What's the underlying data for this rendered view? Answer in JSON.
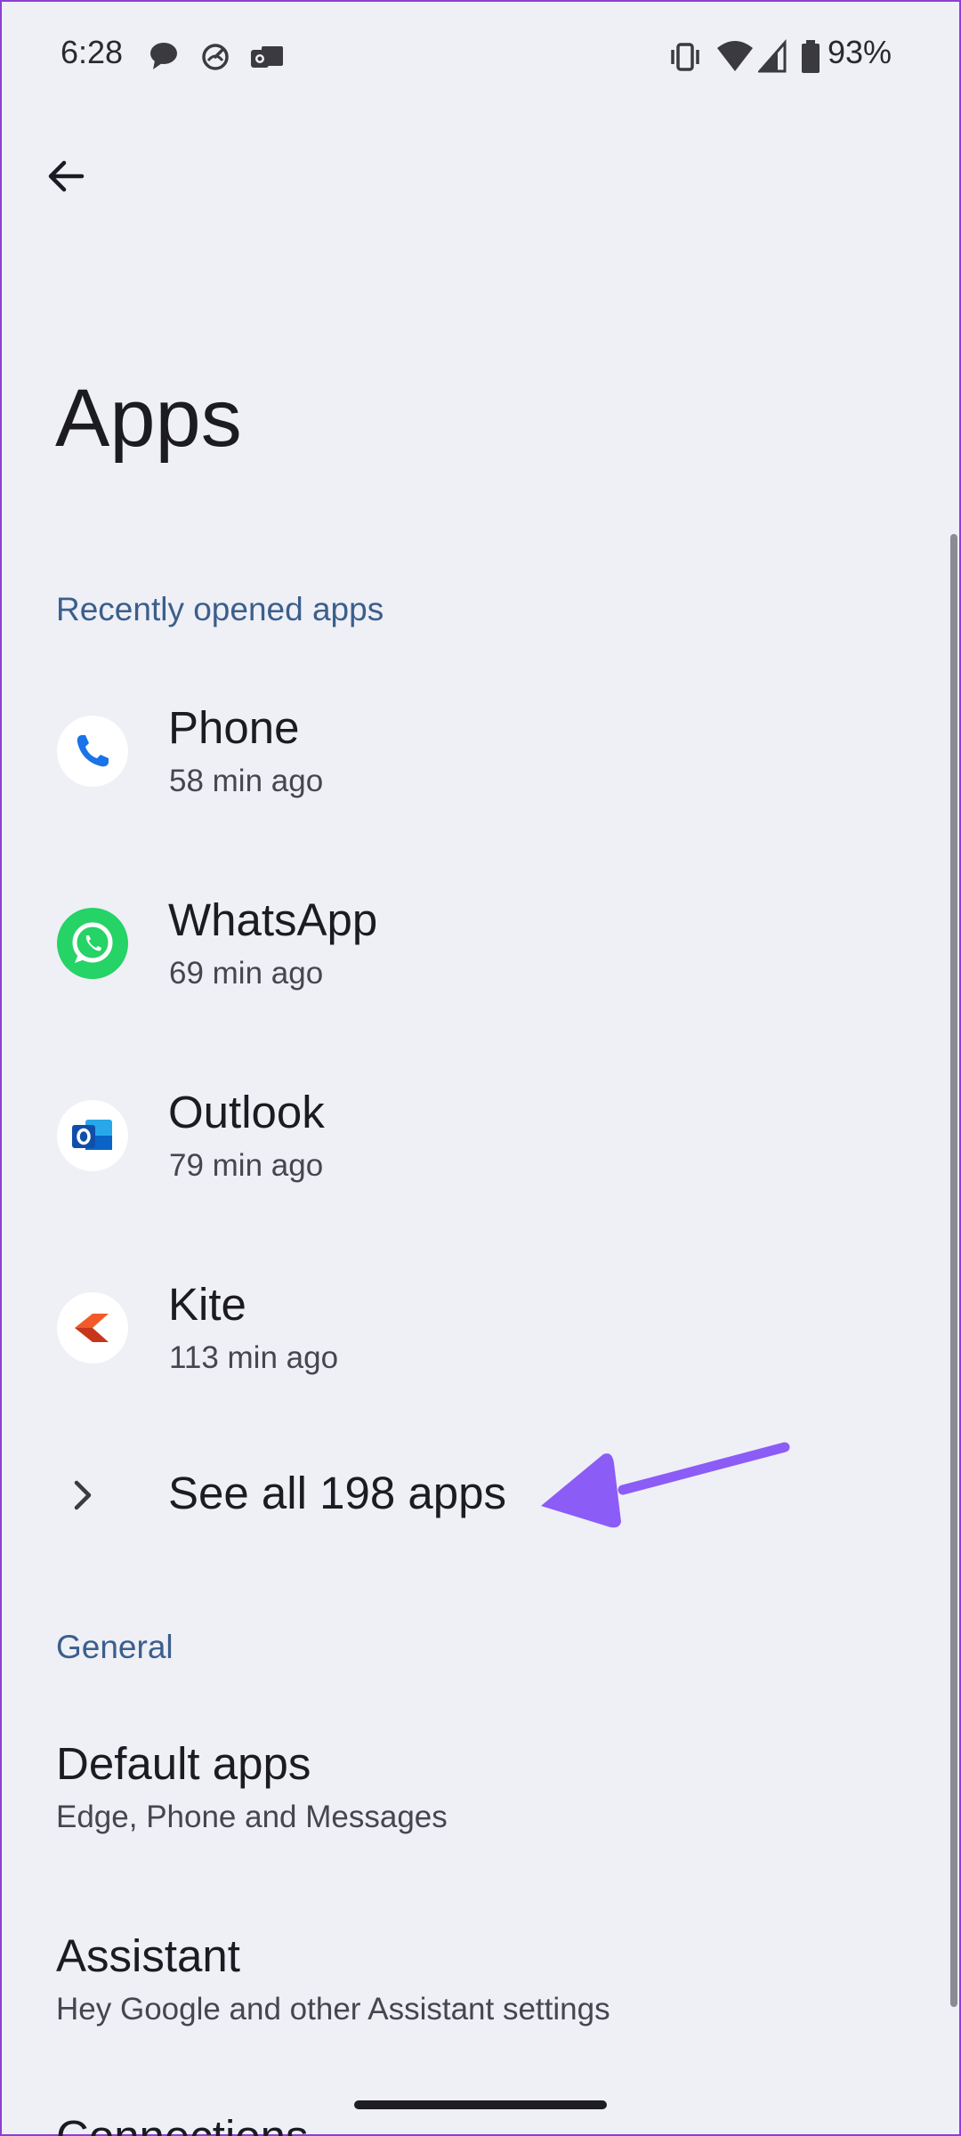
{
  "status_bar": {
    "time": "6:28",
    "battery_percent": "93%",
    "left_icons": [
      "chat-bubble-icon",
      "speed-gauge-icon",
      "outlook-notification-icon"
    ],
    "right_icons": [
      "vibrate-icon",
      "wifi-icon",
      "cell-signal-icon",
      "battery-icon"
    ]
  },
  "header": {
    "title": "Apps"
  },
  "recent": {
    "header": "Recently opened apps",
    "apps": [
      {
        "name": "Phone",
        "time": "58 min ago",
        "icon": "phone-app-icon",
        "color": "#1a73e8"
      },
      {
        "name": "WhatsApp",
        "time": "69 min ago",
        "icon": "whatsapp-app-icon",
        "color": "#25d366"
      },
      {
        "name": "Outlook",
        "time": "79 min ago",
        "icon": "outlook-app-icon",
        "color": "#0a64c8"
      },
      {
        "name": "Kite",
        "time": "113 min ago",
        "icon": "kite-app-icon",
        "color": "#e8492a"
      }
    ],
    "see_all_label": "See all 198 apps"
  },
  "general": {
    "header": "General",
    "items": [
      {
        "title": "Default apps",
        "subtitle": "Edge, Phone and Messages"
      },
      {
        "title": "Assistant",
        "subtitle": "Hey Google and other Assistant settings"
      }
    ],
    "partial_item": "Connections"
  },
  "colors": {
    "background": "#efeff6",
    "section_header": "#3a5f8c",
    "annotation_arrow": "#8b5cf6"
  }
}
